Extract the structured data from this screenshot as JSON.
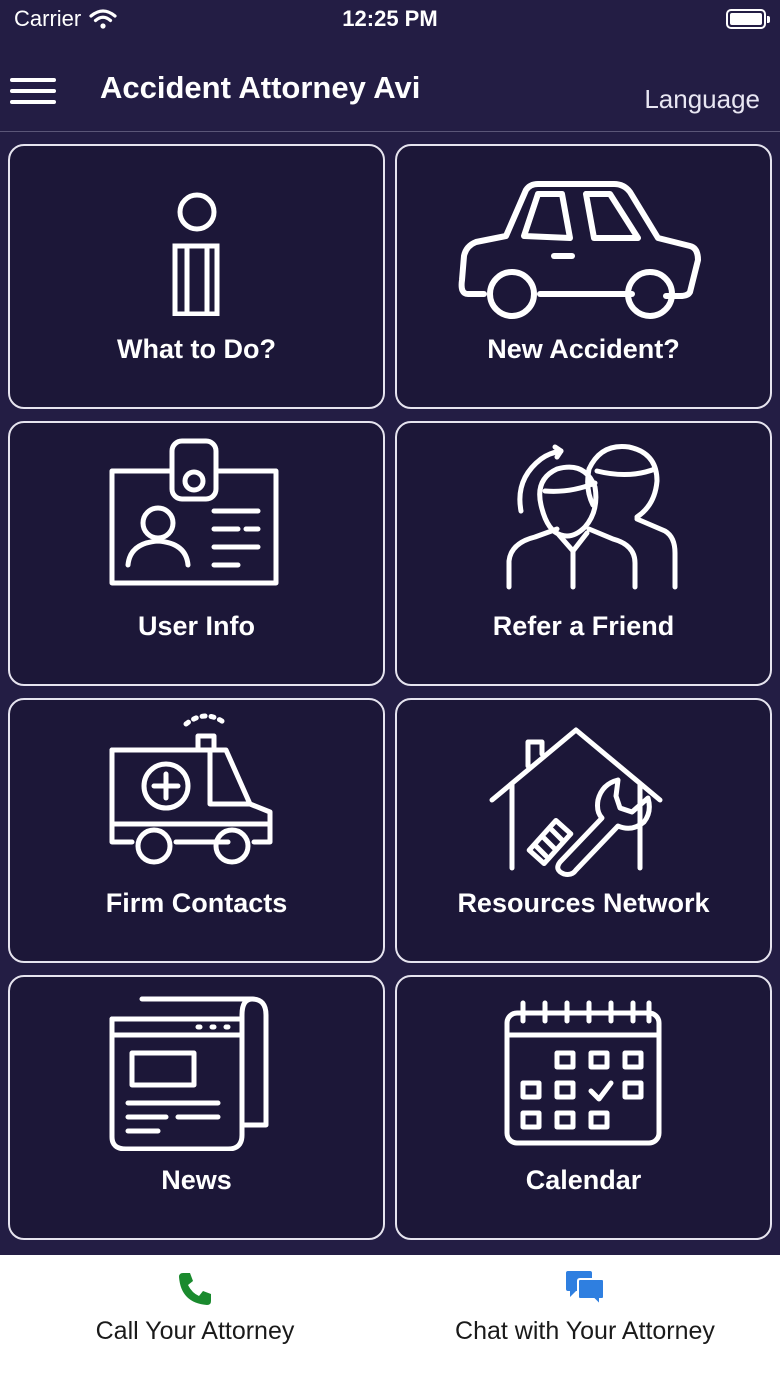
{
  "status_bar": {
    "carrier": "Carrier",
    "time": "12:25 PM"
  },
  "header": {
    "title": "Accident Attorney Avi",
    "language_label": "Language"
  },
  "tiles": [
    {
      "label": "What to Do?",
      "icon": "info-icon"
    },
    {
      "label": "New Accident?",
      "icon": "car-icon"
    },
    {
      "label": "User Info",
      "icon": "id-badge-icon"
    },
    {
      "label": "Refer a Friend",
      "icon": "people-icon"
    },
    {
      "label": "Firm Contacts",
      "icon": "ambulance-icon"
    },
    {
      "label": "Resources Network",
      "icon": "house-tools-icon"
    },
    {
      "label": "News",
      "icon": "newspaper-icon"
    },
    {
      "label": "Calendar",
      "icon": "calendar-icon"
    }
  ],
  "bottom_bar": {
    "call_label": "Call Your Attorney",
    "chat_label": "Chat with Your Attorney"
  },
  "colors": {
    "background": "#231d44",
    "tile_background": "#1c1738",
    "call_icon": "#1a8a2e",
    "chat_icon": "#2f7fe0"
  }
}
